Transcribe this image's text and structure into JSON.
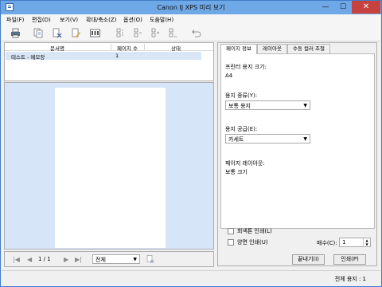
{
  "window": {
    "title": "Canon IJ XPS 미리 보기",
    "min": "—",
    "max": "☐",
    "close": "✕"
  },
  "menu": [
    "파일(F)",
    "편집(D)",
    "보기(V)",
    "확대/축소(Z)",
    "옵션(O)",
    "도움말(H)"
  ],
  "toolbar_icons": [
    "printer-icon",
    "copy-page-icon",
    "delete-page-icon",
    "edit-page-icon",
    "thumbnail-icon",
    "first-doc-icon",
    "prev-doc-icon",
    "next-doc-icon",
    "last-doc-icon",
    "undo-icon"
  ],
  "doclist": {
    "headers": [
      "문서명",
      "페이지 수",
      "상태"
    ],
    "rows": [
      {
        "name": "테스트 - 메모장",
        "pages": "1",
        "status": ""
      }
    ]
  },
  "nav": {
    "page": "1 / 1",
    "select": "전체"
  },
  "tabs": [
    "페이지 정보",
    "레이아웃",
    "수동 컬러 조절"
  ],
  "info": {
    "paper_size_label": "프린터 용지 크기:",
    "paper_size_value": "A4",
    "media_type_label": "용지 종류(Y):",
    "media_type_value": "보통 용지",
    "paper_source_label": "용지 공급(E):",
    "paper_source_value": "카세트",
    "layout_label": "페이지 레이아웃:",
    "layout_value": "보통 크기"
  },
  "options": {
    "grayscale": "회색톤 인쇄(L)",
    "duplex": "양면 인쇄(U)",
    "copies_label": "매수(C):",
    "copies_value": "1"
  },
  "buttons": {
    "exit": "끝내기(I)",
    "print": "인쇄(P)"
  },
  "status": "전체 용지 : 1"
}
